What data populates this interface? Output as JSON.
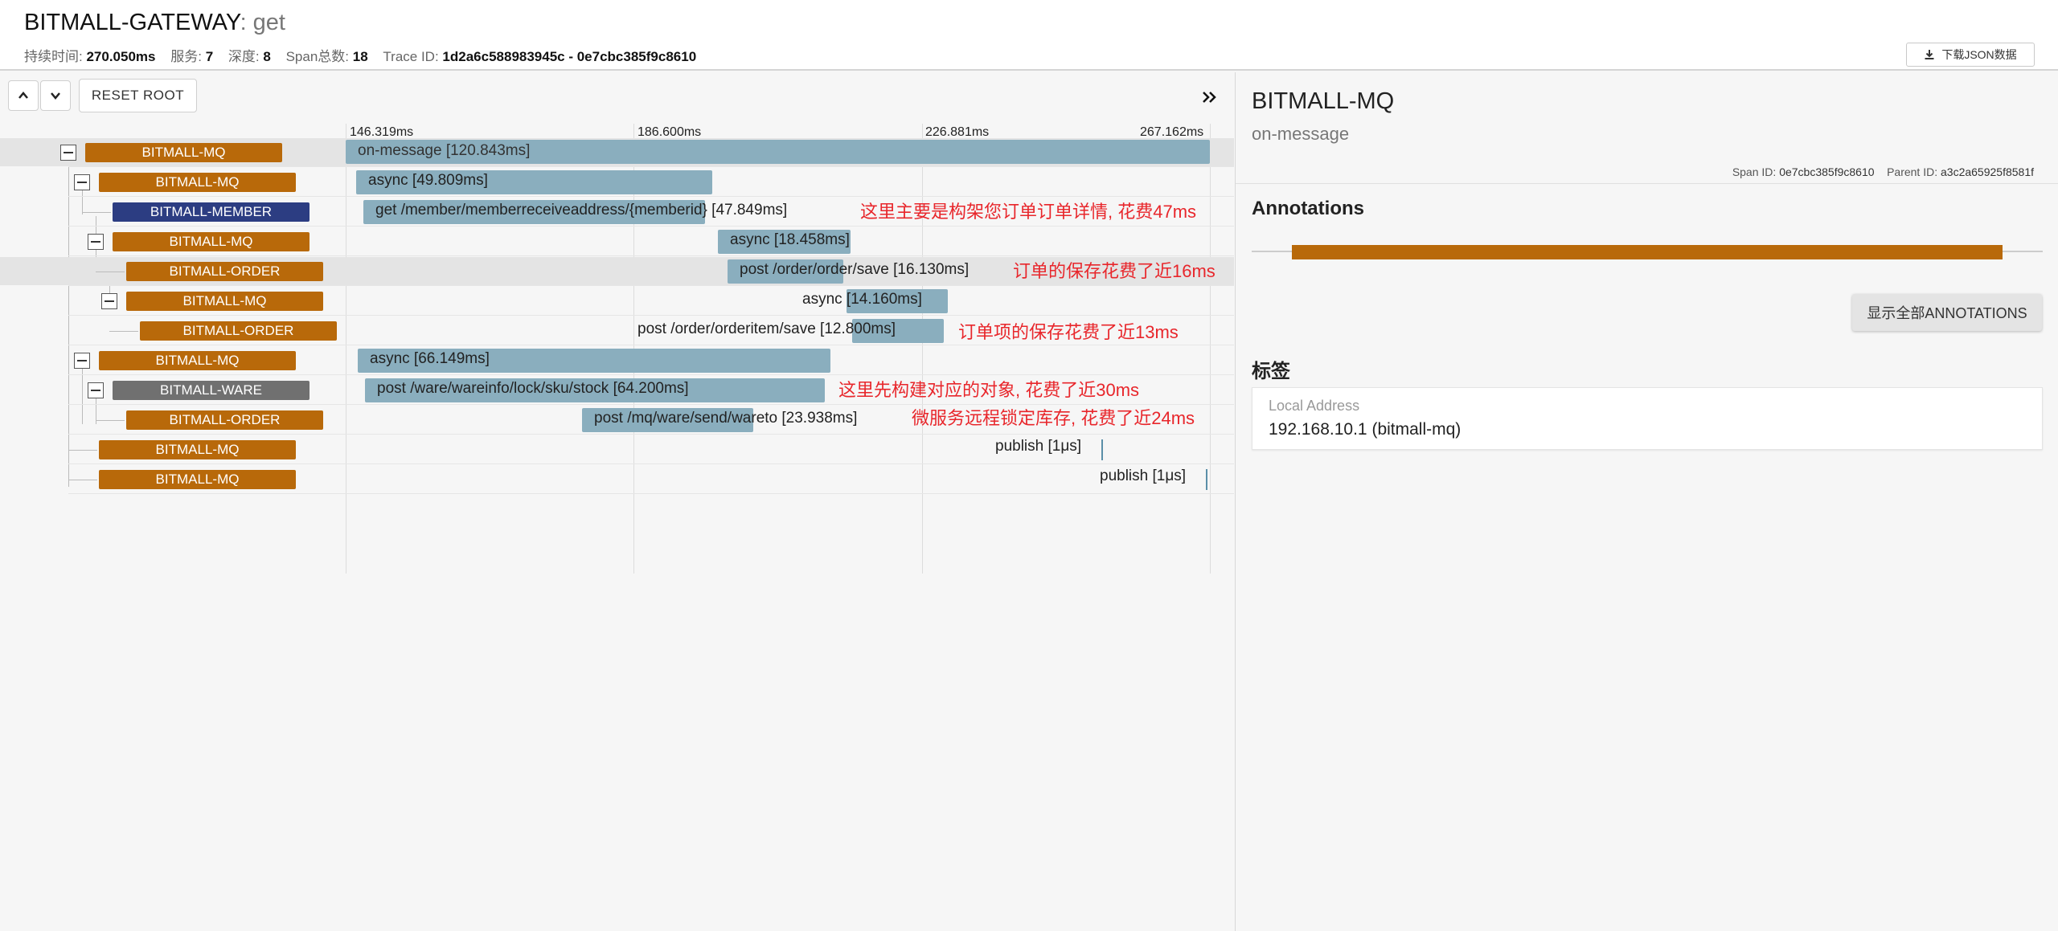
{
  "header": {
    "service": "BITMALL-GATEWAY",
    "operation": ": get",
    "stats": [
      {
        "label": "持续时间:",
        "value": "270.050ms"
      },
      {
        "label": "服务:",
        "value": "7"
      },
      {
        "label": "深度:",
        "value": "8"
      },
      {
        "label": "Span总数:",
        "value": "18"
      },
      {
        "label": "Trace ID:",
        "value": "1d2a6c588983945c - 0e7cbc385f9c8610"
      }
    ],
    "download_label": "下载JSON数据"
  },
  "toolbar": {
    "reset_label": "RESET ROOT"
  },
  "timeline": {
    "ticks": [
      "146.319ms",
      "186.600ms",
      "226.881ms",
      "267.162ms"
    ]
  },
  "spans": [
    {
      "service": "BITMALL-MQ",
      "label": "on-message [120.843ms]",
      "color": "#b8690a"
    },
    {
      "service": "BITMALL-MQ",
      "label": "async [49.809ms]",
      "color": "#b8690a"
    },
    {
      "service": "BITMALL-MEMBER",
      "label": "get /member/memberreceiveaddress/{memberid} [47.849ms]",
      "color": "#2c3d82"
    },
    {
      "service": "BITMALL-MQ",
      "label": "async [18.458ms]",
      "color": "#b8690a"
    },
    {
      "service": "BITMALL-ORDER",
      "label": "post /order/order/save [16.130ms]",
      "color": "#b8690a"
    },
    {
      "service": "BITMALL-MQ",
      "label": "async [14.160ms]",
      "color": "#b8690a"
    },
    {
      "service": "BITMALL-ORDER",
      "label": "post /order/orderitem/save [12.800ms]",
      "color": "#b8690a"
    },
    {
      "service": "BITMALL-MQ",
      "label": "async [66.149ms]",
      "color": "#b8690a"
    },
    {
      "service": "BITMALL-WARE",
      "label": "post /ware/wareinfo/lock/sku/stock [64.200ms]",
      "color": "#707070"
    },
    {
      "service": "BITMALL-ORDER",
      "label": "post /mq/ware/send/wareto [23.938ms]",
      "color": "#b8690a"
    },
    {
      "service": "BITMALL-MQ",
      "label": "publish [1μs]",
      "color": "#b8690a"
    },
    {
      "service": "BITMALL-MQ",
      "label": "publish [1μs]",
      "color": "#b8690a"
    }
  ],
  "notes": [
    "这里主要是构架您订单订单详情, 花费47ms",
    "订单的保存花费了近16ms",
    "订单项的保存花费了近13ms",
    "这里先构建对应的对象, 花费了近30ms",
    "微服务远程锁定库存, 花费了近24ms"
  ],
  "detail": {
    "service": "BITMALL-MQ",
    "operation": "on-message",
    "span_id_label": "Span ID:",
    "span_id": "0e7cbc385f9c8610",
    "parent_id_label": "Parent ID:",
    "parent_id": "a3c2a65925f8581f",
    "annotations_title": "Annotations",
    "show_all_label": "显示全部ANNOTATIONS",
    "tags_title": "标签",
    "tags": [
      {
        "key": "Local Address",
        "value": "192.168.10.1 (bitmall-mq)"
      }
    ]
  },
  "icons": {
    "up": "chevron-up-icon",
    "down": "chevron-down-icon",
    "expand": "double-chevron-right-icon",
    "download": "download-icon"
  }
}
